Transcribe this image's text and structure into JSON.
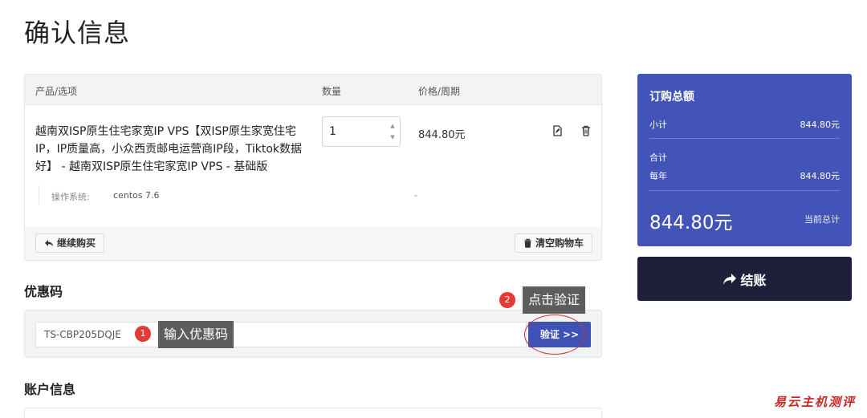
{
  "page": {
    "title": "确认信息"
  },
  "cart": {
    "headers": {
      "product": "产品/选项",
      "quantity": "数量",
      "price": "价格/周期"
    },
    "item": {
      "name": "越南双ISP原生住宅家宽IP VPS【双ISP原生家宽住宅IP，IP质量高，小众西贡邮电运营商IP段，Tiktok数据好】 - 越南双ISP原生住宅家宽IP VPS - 基础版",
      "quantity": "1",
      "price": "844.80元",
      "option_key": "操作系统:",
      "option_value": "centos 7.6",
      "option_price": "-"
    },
    "continue_label": "继续购买",
    "empty_label": "清空购物车"
  },
  "promo": {
    "title": "优惠码",
    "code_value": "TS-CBP205DQJE",
    "verify_label": "验证 >>"
  },
  "annotations": {
    "step1_num": "1",
    "step1_text": "输入优惠码",
    "step2_num": "2",
    "step2_text": "点击验证"
  },
  "account": {
    "title": "账户信息"
  },
  "summary": {
    "title": "订购总额",
    "subtotal_label": "小计",
    "subtotal_value": "844.80元",
    "total_label": "合计",
    "period_label": "每年",
    "period_value": "844.80元",
    "grand_total": "844.80元",
    "grand_total_label": "当前总计"
  },
  "checkout": {
    "label": "结账"
  },
  "watermark": "易云主机测评",
  "colors": {
    "summary_bg": "#4254b8",
    "checkout_bg": "#1e1f3b",
    "verify_bg": "#3f51b5",
    "annotation_red": "#e53935"
  }
}
